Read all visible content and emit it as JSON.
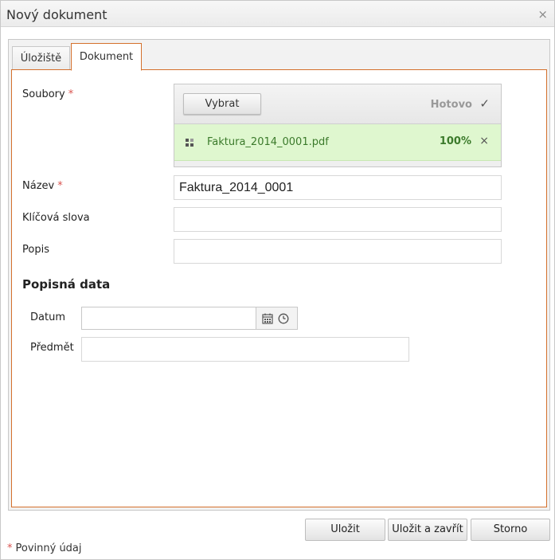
{
  "window": {
    "title": "Nový dokument",
    "close_glyph": "×"
  },
  "tabs": [
    {
      "label": "Úložiště",
      "active": false
    },
    {
      "label": "Dokument",
      "active": true
    }
  ],
  "form": {
    "required_mark": "*",
    "files": {
      "label": "Soubory",
      "select_button": "Vybrat",
      "status": "Hotovo",
      "status_icon": "check-icon",
      "items": [
        {
          "name": "Faktura_2014_0001.pdf",
          "progress": "100%",
          "remove_glyph": "×"
        }
      ]
    },
    "name": {
      "label": "Název",
      "value": "Faktura_2014_0001"
    },
    "keywords": {
      "label": "Klíčová slova",
      "value": ""
    },
    "description": {
      "label": "Popis",
      "value": ""
    }
  },
  "metadata": {
    "title": "Popisná data",
    "date": {
      "label": "Datum",
      "value": ""
    },
    "subject": {
      "label": "Předmět",
      "value": ""
    }
  },
  "footer": {
    "save": "Uložit",
    "save_close": "Uložit a zavřít",
    "cancel": "Storno"
  },
  "legend": {
    "mark": "*",
    "text": "Povinný údaj"
  },
  "colors": {
    "accent": "#d4702c",
    "required": "#d9534f",
    "success_bg": "#dff7cf",
    "success_text": "#3b7a2b"
  }
}
